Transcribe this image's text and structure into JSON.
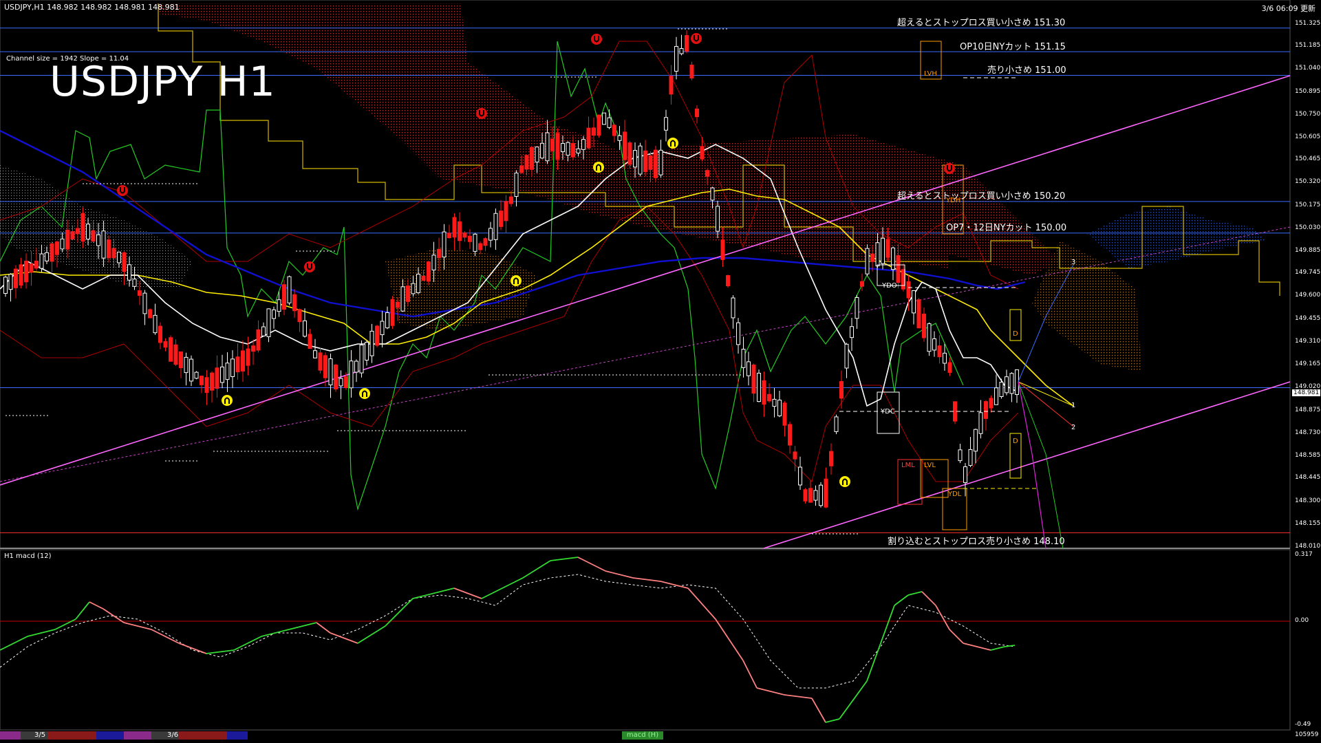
{
  "header": {
    "symbol_info": "USDJPY,H1  148.982 148.982 148.981 148.981",
    "timestamp": "3/6 06:09 更新",
    "channel_info": "Channel size = 1942 Slope = 11.04",
    "title": "USDJPY H1"
  },
  "hlines": [
    {
      "label": "超えるとストップロス買い小さめ 151.30",
      "price": 151.3,
      "color": "#3a6cff"
    },
    {
      "label": "OP10日NYカット 151.15",
      "price": 151.15,
      "color": "#3a6cff"
    },
    {
      "label": "売り小さめ 151.00",
      "price": 151.0,
      "color": "#3a6cff"
    },
    {
      "label": "超えるとストップロス買い小さめ 150.20",
      "price": 150.2,
      "color": "#3a6cff"
    },
    {
      "label": "OP7・12日NYカット 150.00",
      "price": 150.0,
      "color": "#3a6cff"
    },
    {
      "label": "割り込むとストップロス売り小さめ 148.10",
      "price": 148.1,
      "color": "#ff3030"
    }
  ],
  "price_axis": {
    "ticks": [
      "151.325",
      "151.185",
      "151.040",
      "150.895",
      "150.750",
      "150.605",
      "150.465",
      "150.320",
      "150.175",
      "150.030",
      "149.885",
      "149.745",
      "149.600",
      "149.455",
      "149.310",
      "149.165",
      "149.020",
      "148.875",
      "148.730",
      "148.585",
      "148.445",
      "148.300",
      "148.155",
      "148.010"
    ],
    "current": "148.981"
  },
  "macd": {
    "label": "H1  macd (12)",
    "ticks": [
      "0.317",
      "0.00",
      "-0.49"
    ]
  },
  "box_labels": {
    "lvh": "LVH",
    "ydh": "YDH",
    "ydo": "YDO",
    "ydc": "YDC",
    "lml": "LML",
    "lvl": "LVL",
    "ydl": "YDL",
    "d1": "D",
    "d2": "D",
    "n1": "1",
    "n2": "2",
    "n3": "3"
  },
  "bottom_bar": {
    "date1": "3/5",
    "date2": "3/6",
    "tab": "macd (H)",
    "right_number": "105959"
  },
  "colors": {
    "background": "#000000",
    "bull_candle": "#ffffff",
    "bear_candle": "#ff1a1a",
    "ma_white": "#ffffff",
    "ma_yellow": "#ffee00",
    "ma_blue": "#1010d0",
    "channel_pink": "#ff66ff",
    "bollinger_red": "#c00000",
    "chikou_green": "#22cc22",
    "macd_green": "#33dd33",
    "macd_pink": "#ff8080",
    "signal_dotted": "#ffffff"
  },
  "icons": [
    "up-arrow-signal-icon",
    "down-arrow-signal-icon"
  ]
}
